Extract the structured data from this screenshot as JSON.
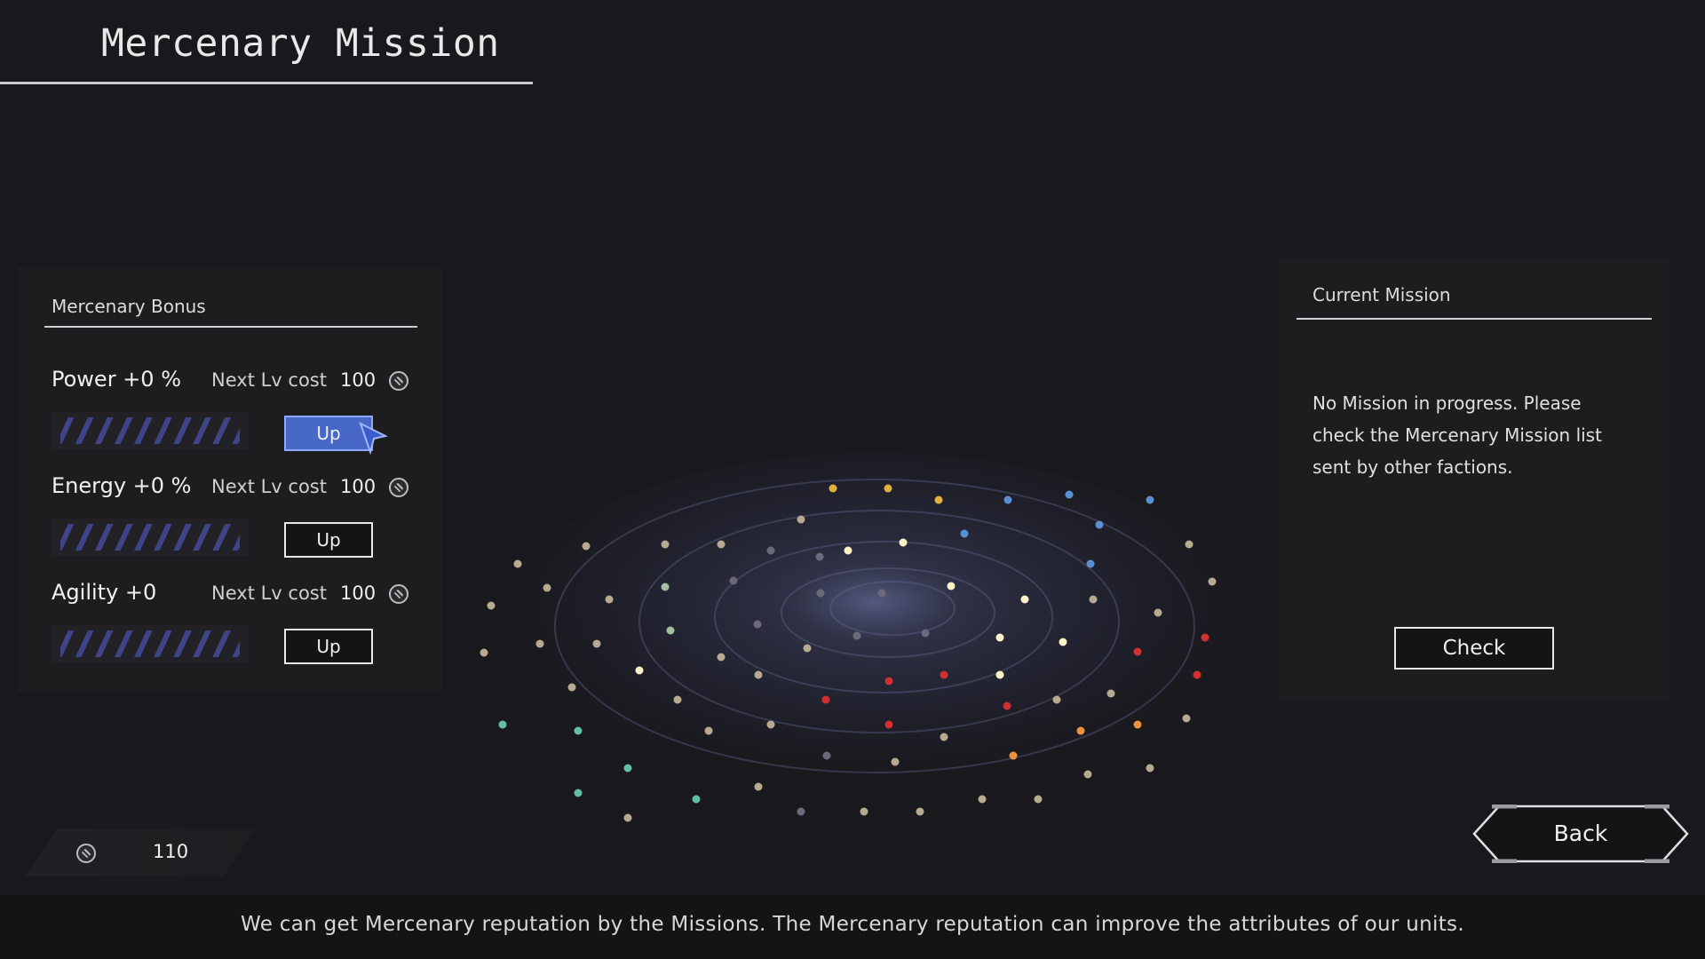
{
  "screen": {
    "title": "Mercenary Mission"
  },
  "bonus_panel": {
    "heading": "Mercenary Bonus",
    "stats": [
      {
        "name": "Power +0 %",
        "cost_label": "Next Lv cost",
        "cost": "100",
        "button": "Up",
        "hovered": true,
        "level_filled": 0,
        "level_max": 10
      },
      {
        "name": "Energy +0 %",
        "cost_label": "Next Lv cost",
        "cost": "100",
        "button": "Up",
        "hovered": false,
        "level_filled": 0,
        "level_max": 10
      },
      {
        "name": "Agility +0",
        "cost_label": "Next Lv cost",
        "cost": "100",
        "button": "Up",
        "hovered": false,
        "level_filled": 0,
        "level_max": 10
      }
    ]
  },
  "mission_panel": {
    "heading": "Current Mission",
    "message": "No Mission in progress. Please check the Mercenary Mission list sent by other factions.",
    "check_button": "Check"
  },
  "reputation": {
    "icon": "mercenary-coin-icon",
    "value": "110"
  },
  "back_button": "Back",
  "footer_text": "We can get Mercenary reputation by the Missions.  The Mercenary reputation can improve the attributes of our units.",
  "colors": {
    "accent_button": "#4868c8",
    "background": "#19191d",
    "panel": "#1d1d20"
  }
}
